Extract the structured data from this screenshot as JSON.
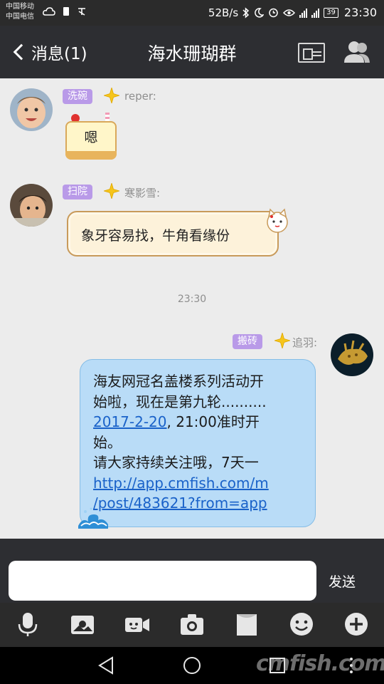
{
  "status_bar": {
    "carrier_1": "中国移动",
    "carrier_2": "中国电信",
    "net_speed": "52B/s",
    "battery": "39",
    "time": "23:30"
  },
  "header": {
    "back_label": "消息(1)",
    "title": "海水珊瑚群"
  },
  "messages": [
    {
      "tag": "洗碗",
      "sender": "reper:",
      "text": "嗯",
      "style": "cake"
    },
    {
      "tag": "扫院",
      "sender": "寒影雪:",
      "text": "象牙容易找，牛角看缘份",
      "style": "scroll"
    },
    {
      "timestamp": "23:30"
    },
    {
      "tag": "搬砖",
      "sender": "追羽:",
      "line_1": "海友网冠名盖楼系列活动开",
      "line_2": "始啦，现在是第九轮..........",
      "date_link": "2017-2-20",
      "after_date": ", 21:00准时开",
      "line_4": "始。",
      "line_5": "请大家持续关注哦，7天一",
      "url_line_1": "http://app.cmfish.com/m",
      "url_line_2": "/post/483621?from=app",
      "style": "ocean"
    }
  ],
  "input": {
    "value": "",
    "send_label": "发送"
  },
  "toolbar_icons": [
    "microphone-icon",
    "photo-icon",
    "video-icon",
    "camera-icon",
    "file-icon",
    "emoji-icon",
    "plus-icon"
  ],
  "watermark": "cmfish.com",
  "colors": {
    "header_bg": "#2d2e32",
    "tag_bg": "#b99ae8",
    "bubble_blue": "#b9dcf7",
    "link": "#1a62c9"
  }
}
